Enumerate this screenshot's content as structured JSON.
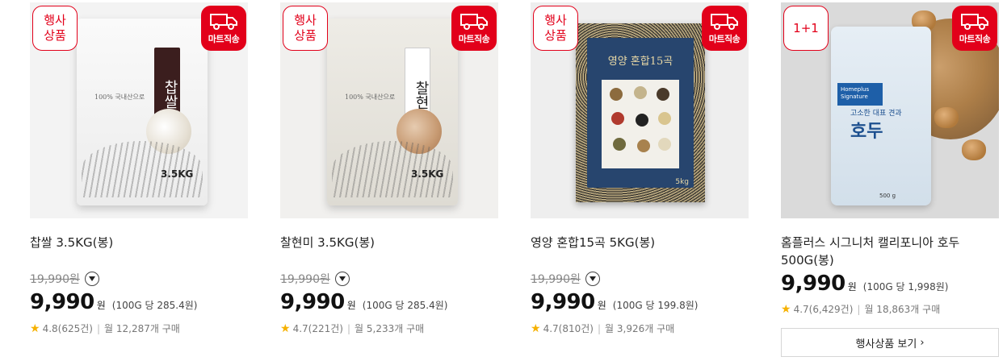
{
  "colors": {
    "accent": "#e2001a",
    "star": "#f6b100"
  },
  "products": [
    {
      "badge": "행사\n상품",
      "delivery_label": "마트직송",
      "pack_weight": "3.5KG",
      "pack_title": "찹쌀",
      "pack_small": "100% 국내산으로",
      "name": "찹쌀 3.5KG(봉)",
      "original_price": "19,990원",
      "price": "9,990",
      "currency": "원",
      "unit_price": "(100G 당 285.4원)",
      "rating": "4.8(625건)",
      "monthly": "월 12,287개 구매"
    },
    {
      "badge": "행사\n상품",
      "delivery_label": "마트직송",
      "pack_weight": "3.5KG",
      "pack_title": "찰현미",
      "pack_small": "100% 국내산으로",
      "name": "찰현미 3.5KG(봉)",
      "original_price": "19,990원",
      "price": "9,990",
      "currency": "원",
      "unit_price": "(100G 당 285.4원)",
      "rating": "4.7(221건)",
      "monthly": "월 5,233개 구매"
    },
    {
      "badge": "행사\n상품",
      "delivery_label": "마트직송",
      "pack_title": "영양 혼합15곡",
      "pack_weight": "5kg",
      "name": "영양 혼합15곡 5KG(봉)",
      "original_price": "19,990원",
      "price": "9,990",
      "currency": "원",
      "unit_price": "(100G 당 199.8원)",
      "rating": "4.7(810건)",
      "monthly": "월 3,926개 구매"
    },
    {
      "badge": "1+1",
      "delivery_label": "마트직송",
      "pack_brand": "Homeplus Signature",
      "pack_sub": "고소한 대표 견과",
      "pack_title": "호두",
      "pack_weight": "500 g",
      "name": "홈플러스 시그니처 캘리포니아 호두 500G(봉)",
      "price": "9,990",
      "currency": "원",
      "unit_price": "(100G 당 1,998원)",
      "rating": "4.7(6,429건)",
      "monthly": "월 18,863개 구매",
      "promo_link": "행사상품 보기"
    }
  ]
}
